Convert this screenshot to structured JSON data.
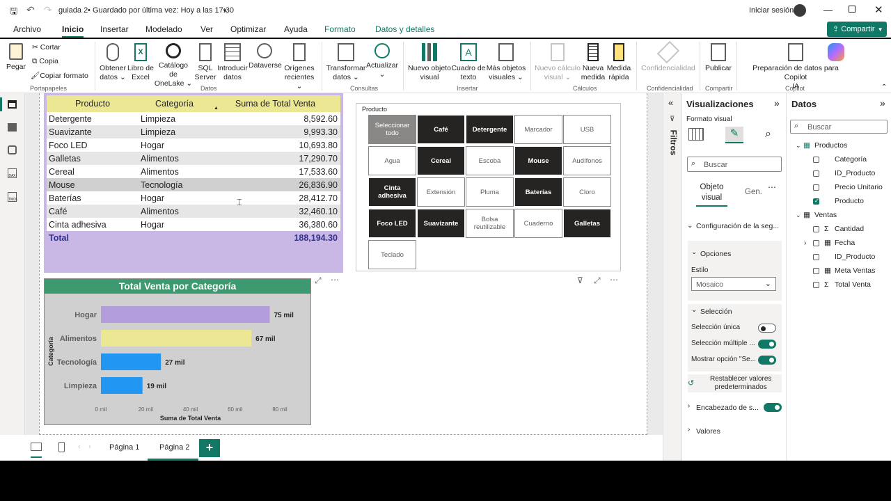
{
  "titlebar": {
    "doc_title": "guiada 2",
    "saved": "Guardado por última vez: Hoy a las 17:30",
    "signin": "Iniciar sesión"
  },
  "menu": {
    "items": [
      "Archivo",
      "Inicio",
      "Insertar",
      "Modelado",
      "Ver",
      "Optimizar",
      "Ayuda",
      "Formato",
      "Datos y detalles"
    ],
    "share": "Compartir"
  },
  "ribbon": {
    "pegar": "Pegar",
    "cortar": "Cortar",
    "copia": "Copia",
    "copiar_formato": "Copiar formato",
    "portapapeles": "Portapapeles",
    "obtener": [
      "Obtener",
      "datos"
    ],
    "libro": [
      "Libro de",
      "Excel"
    ],
    "catalogo": [
      "Catálogo de",
      "OneLake"
    ],
    "sql": [
      "SQL",
      "Server"
    ],
    "introducir": [
      "Introducir",
      "datos"
    ],
    "dataverse": "Dataverse",
    "origenes": [
      "Orígenes",
      "recientes"
    ],
    "datos": "Datos",
    "transformar": [
      "Transformar",
      "datos"
    ],
    "actualizar": "Actualizar",
    "consultas": "Consultas",
    "nuevo_objeto": [
      "Nuevo objeto",
      "visual"
    ],
    "cuadro_texto": [
      "Cuadro de",
      "texto"
    ],
    "mas_objetos": [
      "Más objetos",
      "visuales"
    ],
    "insertar": "Insertar",
    "nuevo_calculo": [
      "Nuevo cálculo",
      "visual"
    ],
    "nueva_medida": [
      "Nueva",
      "medida"
    ],
    "medida_rapida": [
      "Medida",
      "rápida"
    ],
    "calculos": "Cálculos",
    "confidencialidad": "Confidencialidad",
    "confidencialidad_grp": "Confidencialidad",
    "publicar": "Publicar",
    "compartir_grp": "Compartir",
    "preparacion": [
      "Preparación de datos para Copilot",
      "IA"
    ],
    "copilot_grp": "Copilot"
  },
  "table": {
    "headers": [
      "Producto",
      "Categoría",
      "Suma de Total Venta"
    ],
    "rows": [
      [
        "Detergente",
        "Limpieza",
        "8,592.60"
      ],
      [
        "Suavizante",
        "Limpieza",
        "9,993.30"
      ],
      [
        "Foco LED",
        "Hogar",
        "10,693.80"
      ],
      [
        "Galletas",
        "Alimentos",
        "17,290.70"
      ],
      [
        "Cereal",
        "Alimentos",
        "17,533.60"
      ],
      [
        "Mouse",
        "Tecnología",
        "26,836.90"
      ],
      [
        "Baterías",
        "Hogar",
        "28,412.70"
      ],
      [
        "Café",
        "Alimentos",
        "32,460.10"
      ],
      [
        "Cinta adhesiva",
        "Hogar",
        "36,380.60"
      ]
    ],
    "total_label": "Total",
    "total_value": "188,194.30"
  },
  "slicer": {
    "title": "Producto",
    "tiles": [
      {
        "label": "Seleccionar todo",
        "state": "all"
      },
      {
        "label": "Café",
        "state": "sel"
      },
      {
        "label": "Detergente",
        "state": "sel"
      },
      {
        "label": "Marcador",
        "state": "off"
      },
      {
        "label": "USB",
        "state": "off"
      },
      {
        "label": "Agua",
        "state": "off"
      },
      {
        "label": "Cereal",
        "state": "sel"
      },
      {
        "label": "Escoba",
        "state": "off"
      },
      {
        "label": "Mouse",
        "state": "sel"
      },
      {
        "label": "Audífonos",
        "state": "off"
      },
      {
        "label": "Cinta adhesiva",
        "state": "sel"
      },
      {
        "label": "Extensión",
        "state": "off"
      },
      {
        "label": "Pluma",
        "state": "off"
      },
      {
        "label": "Baterías",
        "state": "sel"
      },
      {
        "label": "Cloro",
        "state": "off"
      },
      {
        "label": "Foco LED",
        "state": "sel"
      },
      {
        "label": "Suavizante",
        "state": "sel"
      },
      {
        "label": "Bolsa reutilizable",
        "state": "off"
      },
      {
        "label": "Cuaderno",
        "state": "off"
      },
      {
        "label": "Galletas",
        "state": "sel"
      },
      {
        "label": "Teclado",
        "state": "off"
      }
    ]
  },
  "chart_data": {
    "type": "bar",
    "orientation": "horizontal",
    "title": "Total Venta por Categoría",
    "xlabel": "Suma de Total Venta",
    "ylabel": "Categoría",
    "categories": [
      "Hogar",
      "Alimentos",
      "Tecnología",
      "Limpieza"
    ],
    "values": [
      75487.1,
      67284.4,
      26836.9,
      18585.9
    ],
    "data_labels": [
      "75 mil",
      "67 mil",
      "27 mil",
      "19 mil"
    ],
    "colors": [
      "#b39ddb",
      "#ece793",
      "#2196f3",
      "#2196f3"
    ],
    "xticks": [
      "0 mil",
      "20 mil",
      "40 mil",
      "60 mil",
      "80 mil"
    ],
    "xlim": [
      0,
      80000
    ]
  },
  "pages": {
    "tabs": [
      "Página 1",
      "Página 2"
    ],
    "active": "Página 2"
  },
  "filters": {
    "label": "Filtros"
  },
  "viz": {
    "title": "Visualizaciones",
    "formato": "Formato visual",
    "search": "Buscar",
    "tab_objeto": "Objeto visual",
    "tab_gen": "Gen.",
    "config": "Configuración de la seg...",
    "opciones": "Opciones",
    "estilo": "Estilo",
    "estilo_value": "Mosaico",
    "seleccion": "Selección",
    "sel_unica": "Selección única",
    "sel_multiple": "Selección múltiple ...",
    "mostrar": "Mostrar opción \"Se...",
    "restablecer": [
      "Restablecer valores",
      "predeterminados"
    ],
    "encabezado": "Encabezado de s...",
    "valores": "Valores"
  },
  "datos": {
    "title": "Datos",
    "search": "Buscar",
    "productos": "Productos",
    "productos_fields": [
      {
        "name": "Categoría",
        "checked": false
      },
      {
        "name": "ID_Producto",
        "checked": false
      },
      {
        "name": "Precio Unitario",
        "checked": false
      },
      {
        "name": "Producto",
        "checked": true
      }
    ],
    "ventas": "Ventas",
    "ventas_fields": [
      {
        "name": "Cantidad",
        "icon": "Σ"
      },
      {
        "name": "Fecha",
        "icon": "▦"
      },
      {
        "name": "ID_Producto",
        "icon": ""
      },
      {
        "name": "Meta Ventas",
        "icon": "▦"
      },
      {
        "name": "Total Venta",
        "icon": "Σ"
      }
    ]
  }
}
